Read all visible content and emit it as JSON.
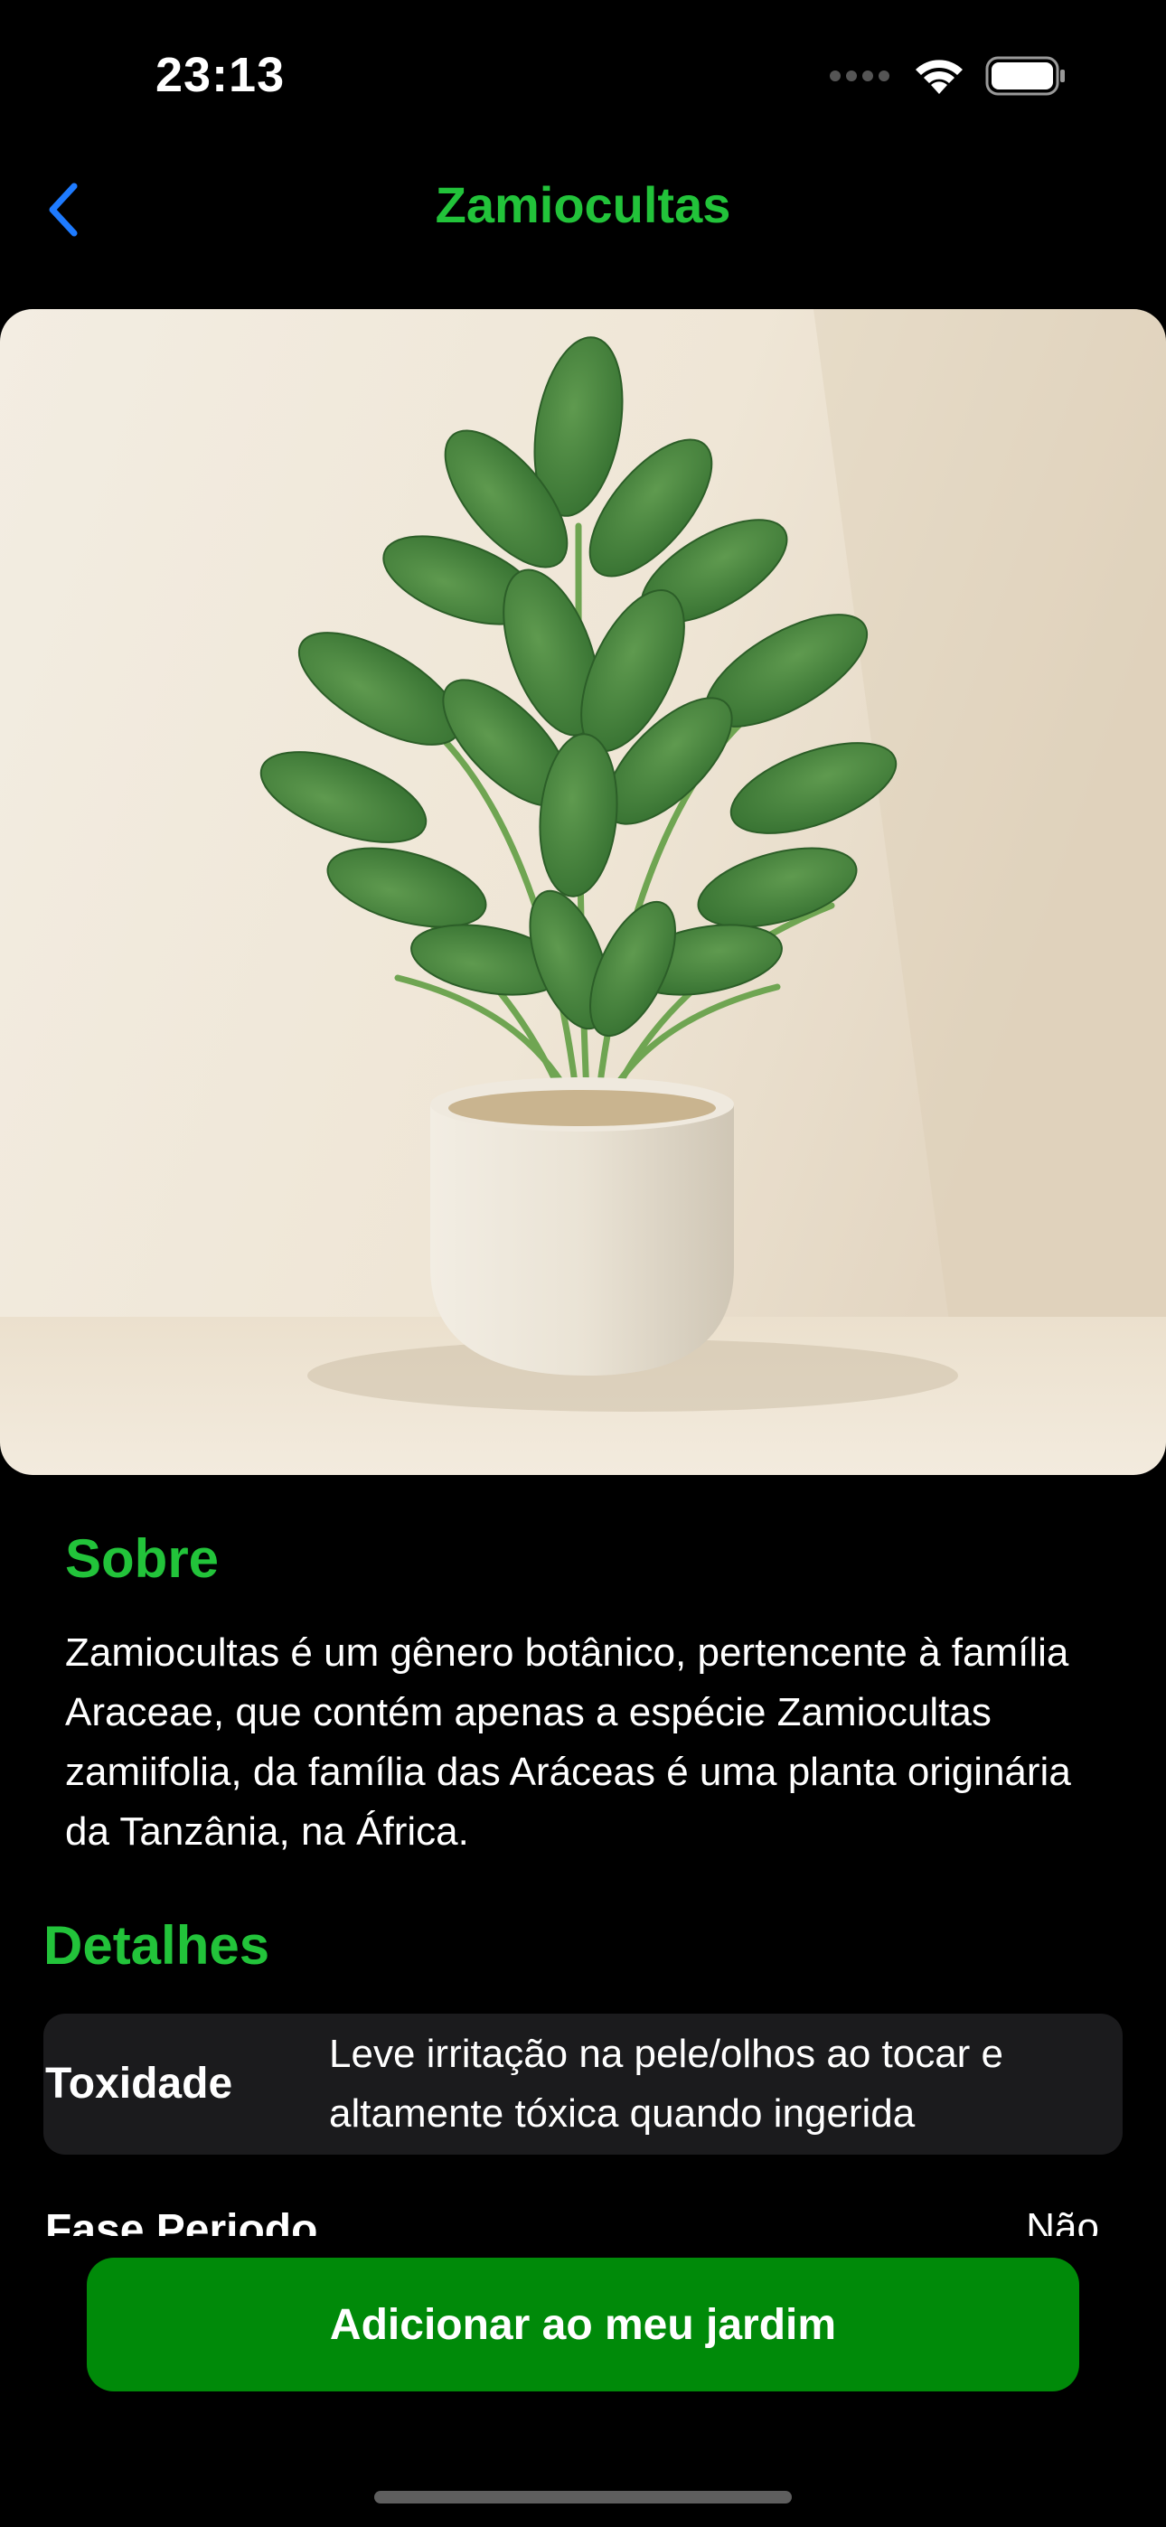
{
  "status_bar": {
    "time": "23:13",
    "icons": [
      "cellular-signal-icon",
      "wifi-icon",
      "battery-icon"
    ]
  },
  "nav": {
    "back_icon": "chevron-left-icon",
    "title": "Zamiocultas"
  },
  "hero_image": {
    "subject": "plant-photo"
  },
  "about": {
    "title": "Sobre",
    "text": "Zamiocultas é um gênero botânico, pertencente à família Araceae, que contém apenas a espécie Zamiocultas zamiifolia, da família das Aráceas é uma planta originária da Tanzânia, na África."
  },
  "details": {
    "title": "Detalhes",
    "rows": [
      {
        "label": "Toxidade",
        "value": "Leve irritação na pele/olhos ao tocar e altamente tóxica quando ingerida"
      },
      {
        "label": "Fase Periodo",
        "value": "Não"
      }
    ]
  },
  "action": {
    "add_label": "Adicionar ao meu jardim"
  },
  "colors": {
    "accent": "#22c33a",
    "button": "#008a09",
    "back": "#1e7bff",
    "background": "#000000",
    "card": "#1b1b1d"
  }
}
